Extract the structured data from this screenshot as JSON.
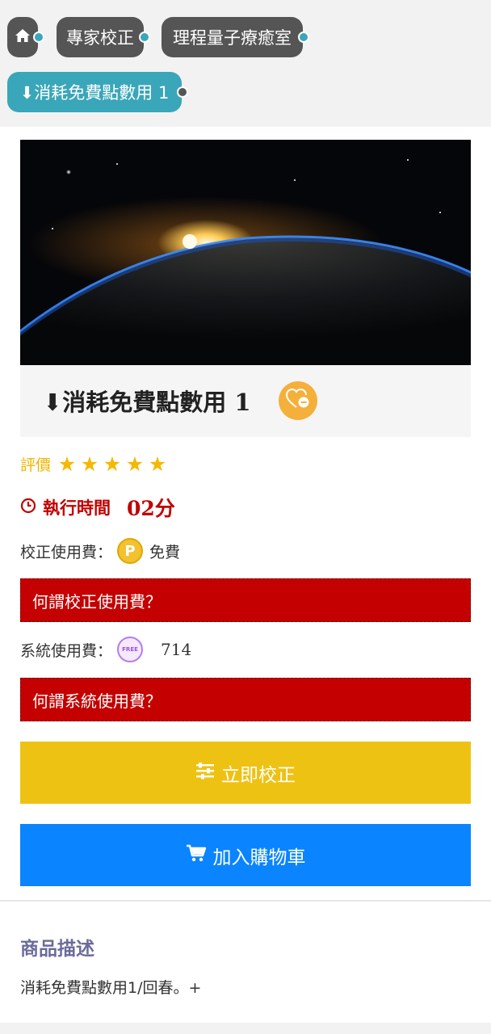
{
  "breadcrumb": {
    "items": [
      {
        "label": ""
      },
      {
        "label": "專家校正"
      },
      {
        "label": "理程量子療癒室"
      },
      {
        "label": "⬇消耗免費點數用 1"
      }
    ]
  },
  "product": {
    "title": "⬇消耗免費點數用 1",
    "rating_label": "評價",
    "rating_value": 5,
    "stars": [
      "★",
      "★",
      "★",
      "★",
      "★"
    ],
    "exec_label": "執行時間",
    "exec_value": "02分",
    "calibration_fee_label": "校正使用費：",
    "calibration_fee_value": "免費",
    "calibration_fee_coin": "P",
    "calibration_fee_help": "何謂校正使用費？",
    "system_fee_label": "系統使用費：",
    "system_fee_value": "714",
    "system_fee_coin": "FREE",
    "system_fee_help": "何謂系統使用費？"
  },
  "actions": {
    "calibrate_label": "立即校正",
    "add_to_cart_label": "加入購物車"
  },
  "description": {
    "title": "商品描述",
    "text": "消耗免費點數用1/回春。+"
  },
  "colors": {
    "crumb_bg": "#555555",
    "crumb_active": "#3aa6b9",
    "alert_red": "#c40000",
    "calibrate_yellow": "#eec213",
    "cart_blue": "#0a84ff",
    "star_gold": "#f5b800"
  },
  "icons": [
    "home-icon",
    "heart-minus-icon",
    "star-icon",
    "clock-icon",
    "p-coin-icon",
    "free-coin-icon",
    "sliders-icon",
    "cart-icon"
  ]
}
